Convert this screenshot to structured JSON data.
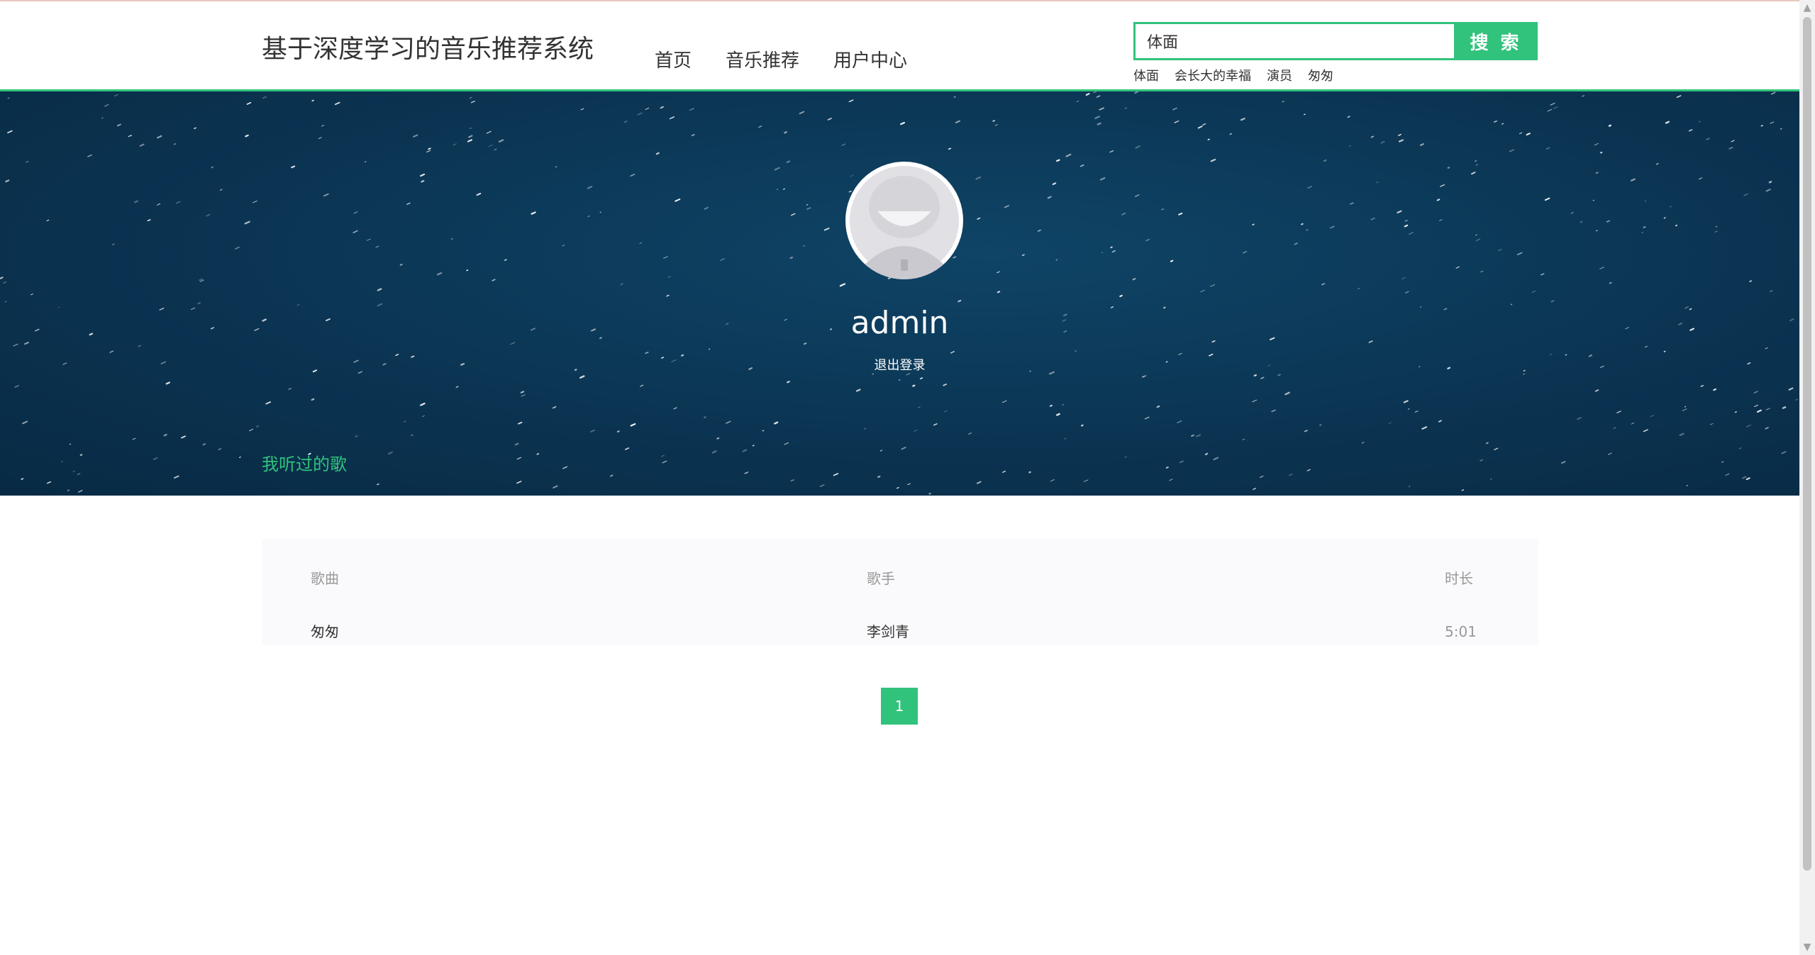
{
  "header": {
    "site_title": "基于深度学习的音乐推荐系统",
    "nav": {
      "home": "首页",
      "recommend": "音乐推荐",
      "user_center": "用户中心"
    },
    "search": {
      "value": "体面",
      "placeholder": "体面",
      "button_label": "搜 索"
    },
    "hot_words": [
      "体面",
      "会长大的幸福",
      "演员",
      "匆匆"
    ]
  },
  "profile": {
    "username": "admin",
    "logout_label": "退出登录",
    "tab_label": "我听过的歌"
  },
  "song_table": {
    "columns": [
      "歌曲",
      "歌手",
      "时长"
    ],
    "rows": [
      {
        "song": "匆匆",
        "artist": "李剑青",
        "duration": "5:01"
      }
    ]
  },
  "pagination": {
    "current_page": "1"
  },
  "colors": {
    "accent": "#31c27c",
    "banner": "#0b3452"
  },
  "icons": {
    "scroll_up": "scroll-up-arrow-icon",
    "scroll_down": "scroll-down-arrow-icon"
  }
}
